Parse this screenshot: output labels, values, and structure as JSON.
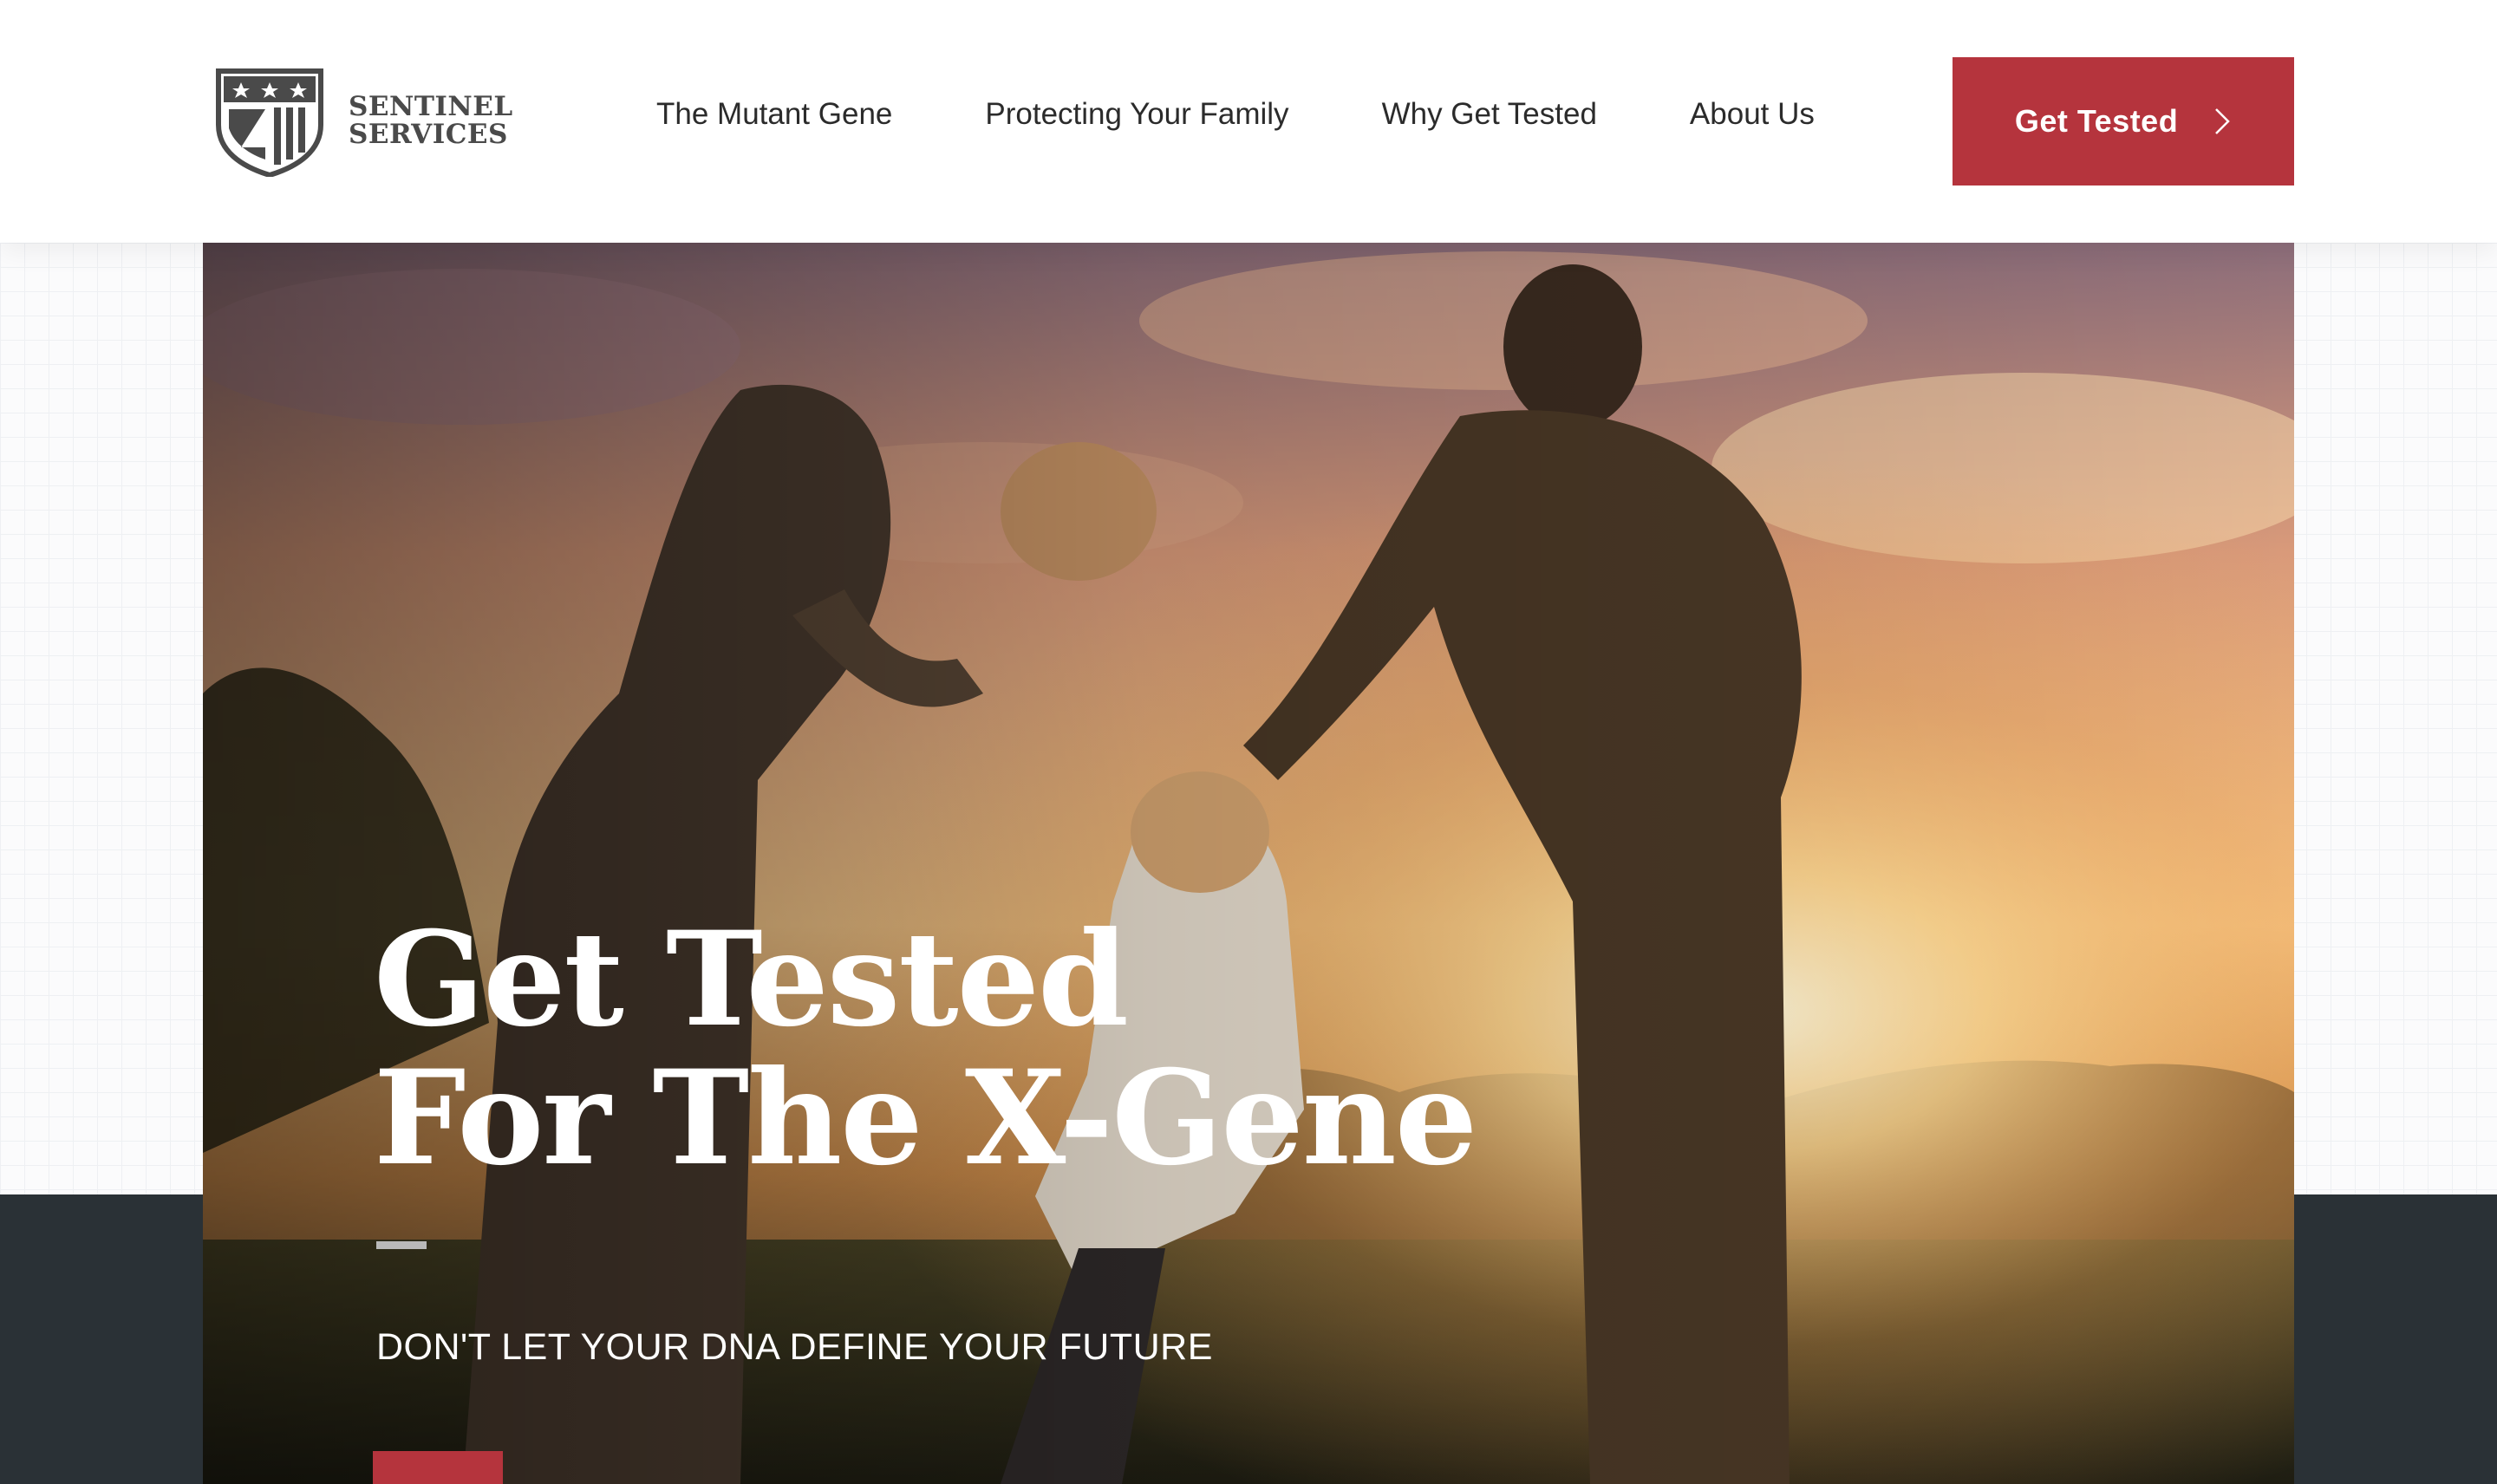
{
  "brand": {
    "name_line1": "SENTINEL",
    "name_line2": "SERVICES",
    "logo_icon": "shield-stars-icon"
  },
  "nav": {
    "items": [
      {
        "label": "The Mutant Gene"
      },
      {
        "label": "Protecting Your Family"
      },
      {
        "label": "Why Get Tested"
      },
      {
        "label": "About Us"
      }
    ]
  },
  "header_cta": {
    "label": "Get Tested",
    "icon": "chevron-right-icon"
  },
  "hero": {
    "title_line1": "Get Tested",
    "title_line2": "For The X-Gene",
    "tagline": "DON'T LET YOUR DNA DEFINE YOUR FUTURE",
    "image_alt": "family-swinging-child-sunset-photo"
  },
  "colors": {
    "accent": "#b5343d",
    "dark_band": "#2a3136",
    "text_dark": "#2b2b2b",
    "logo_gray": "#4a4a4a"
  }
}
